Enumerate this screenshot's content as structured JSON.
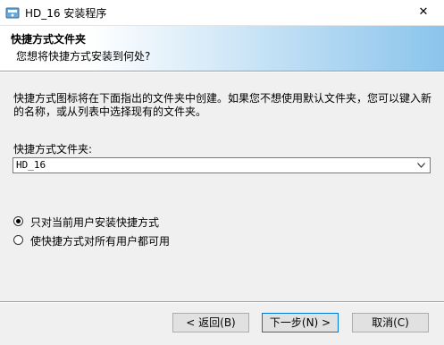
{
  "window": {
    "title": "HD_16 安装程序",
    "close_glyph": "✕"
  },
  "header": {
    "title": "快捷方式文件夹",
    "subtitle": "您想将快捷方式安装到何处?"
  },
  "body": {
    "description": "快捷方式图标将在下面指出的文件夹中创建。如果您不想使用默认文件夹，您可以键入新的名称，或从列表中选择现有的文件夹。",
    "folder_label": "快捷方式文件夹:",
    "folder_value": "HD_16"
  },
  "options": {
    "current_user": "只对当前用户安装快捷方式",
    "all_users": "使快捷方式对所有用户都可用",
    "selected": "current_user"
  },
  "buttons": {
    "back": "< 返回(B)",
    "next": "下一步(N) >",
    "cancel": "取消(C)"
  },
  "colors": {
    "accent": "#0078d7",
    "header_gradient_end": "#8ac4ec"
  }
}
